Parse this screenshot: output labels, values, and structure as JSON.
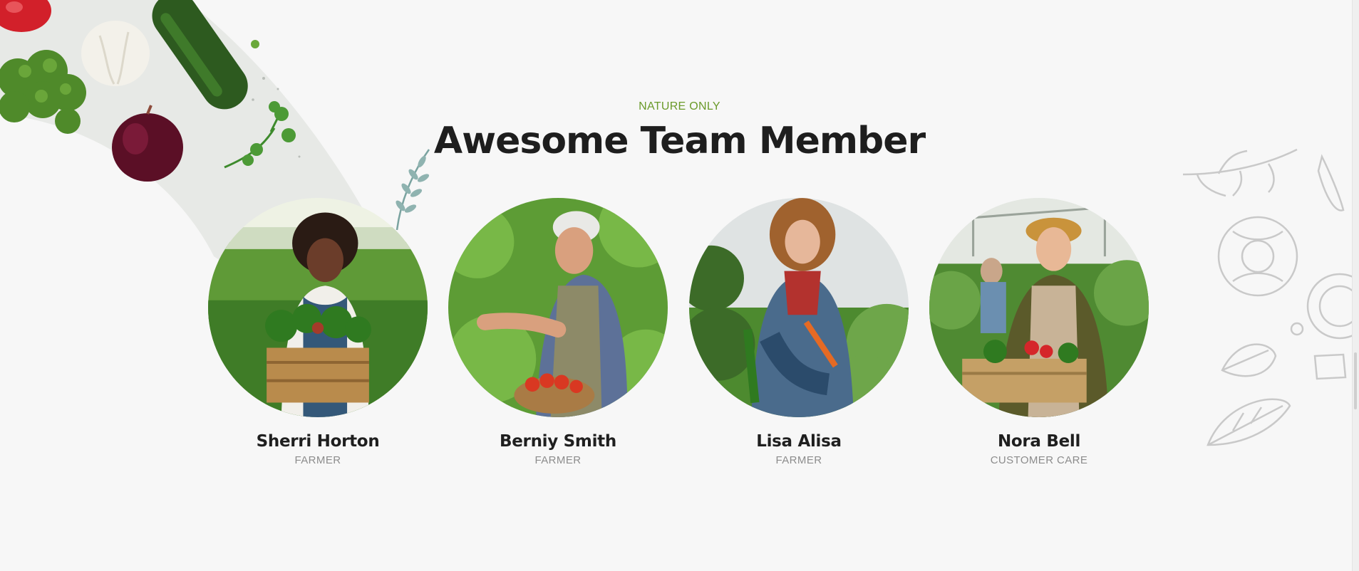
{
  "section": {
    "eyebrow": "NATURE ONLY",
    "title": "Awesome Team Member"
  },
  "team": [
    {
      "name": "Sherri Horton",
      "role": "FARMER"
    },
    {
      "name": "Berniy Smith",
      "role": "FARMER"
    },
    {
      "name": "Lisa Alisa",
      "role": "FARMER"
    },
    {
      "name": "Nora Bell",
      "role": "CUSTOMER CARE"
    }
  ],
  "colors": {
    "accent_green": "#6a9a2a",
    "heading": "#1e1e1e",
    "role_text": "#8c8c8c",
    "background": "#f7f7f7"
  }
}
